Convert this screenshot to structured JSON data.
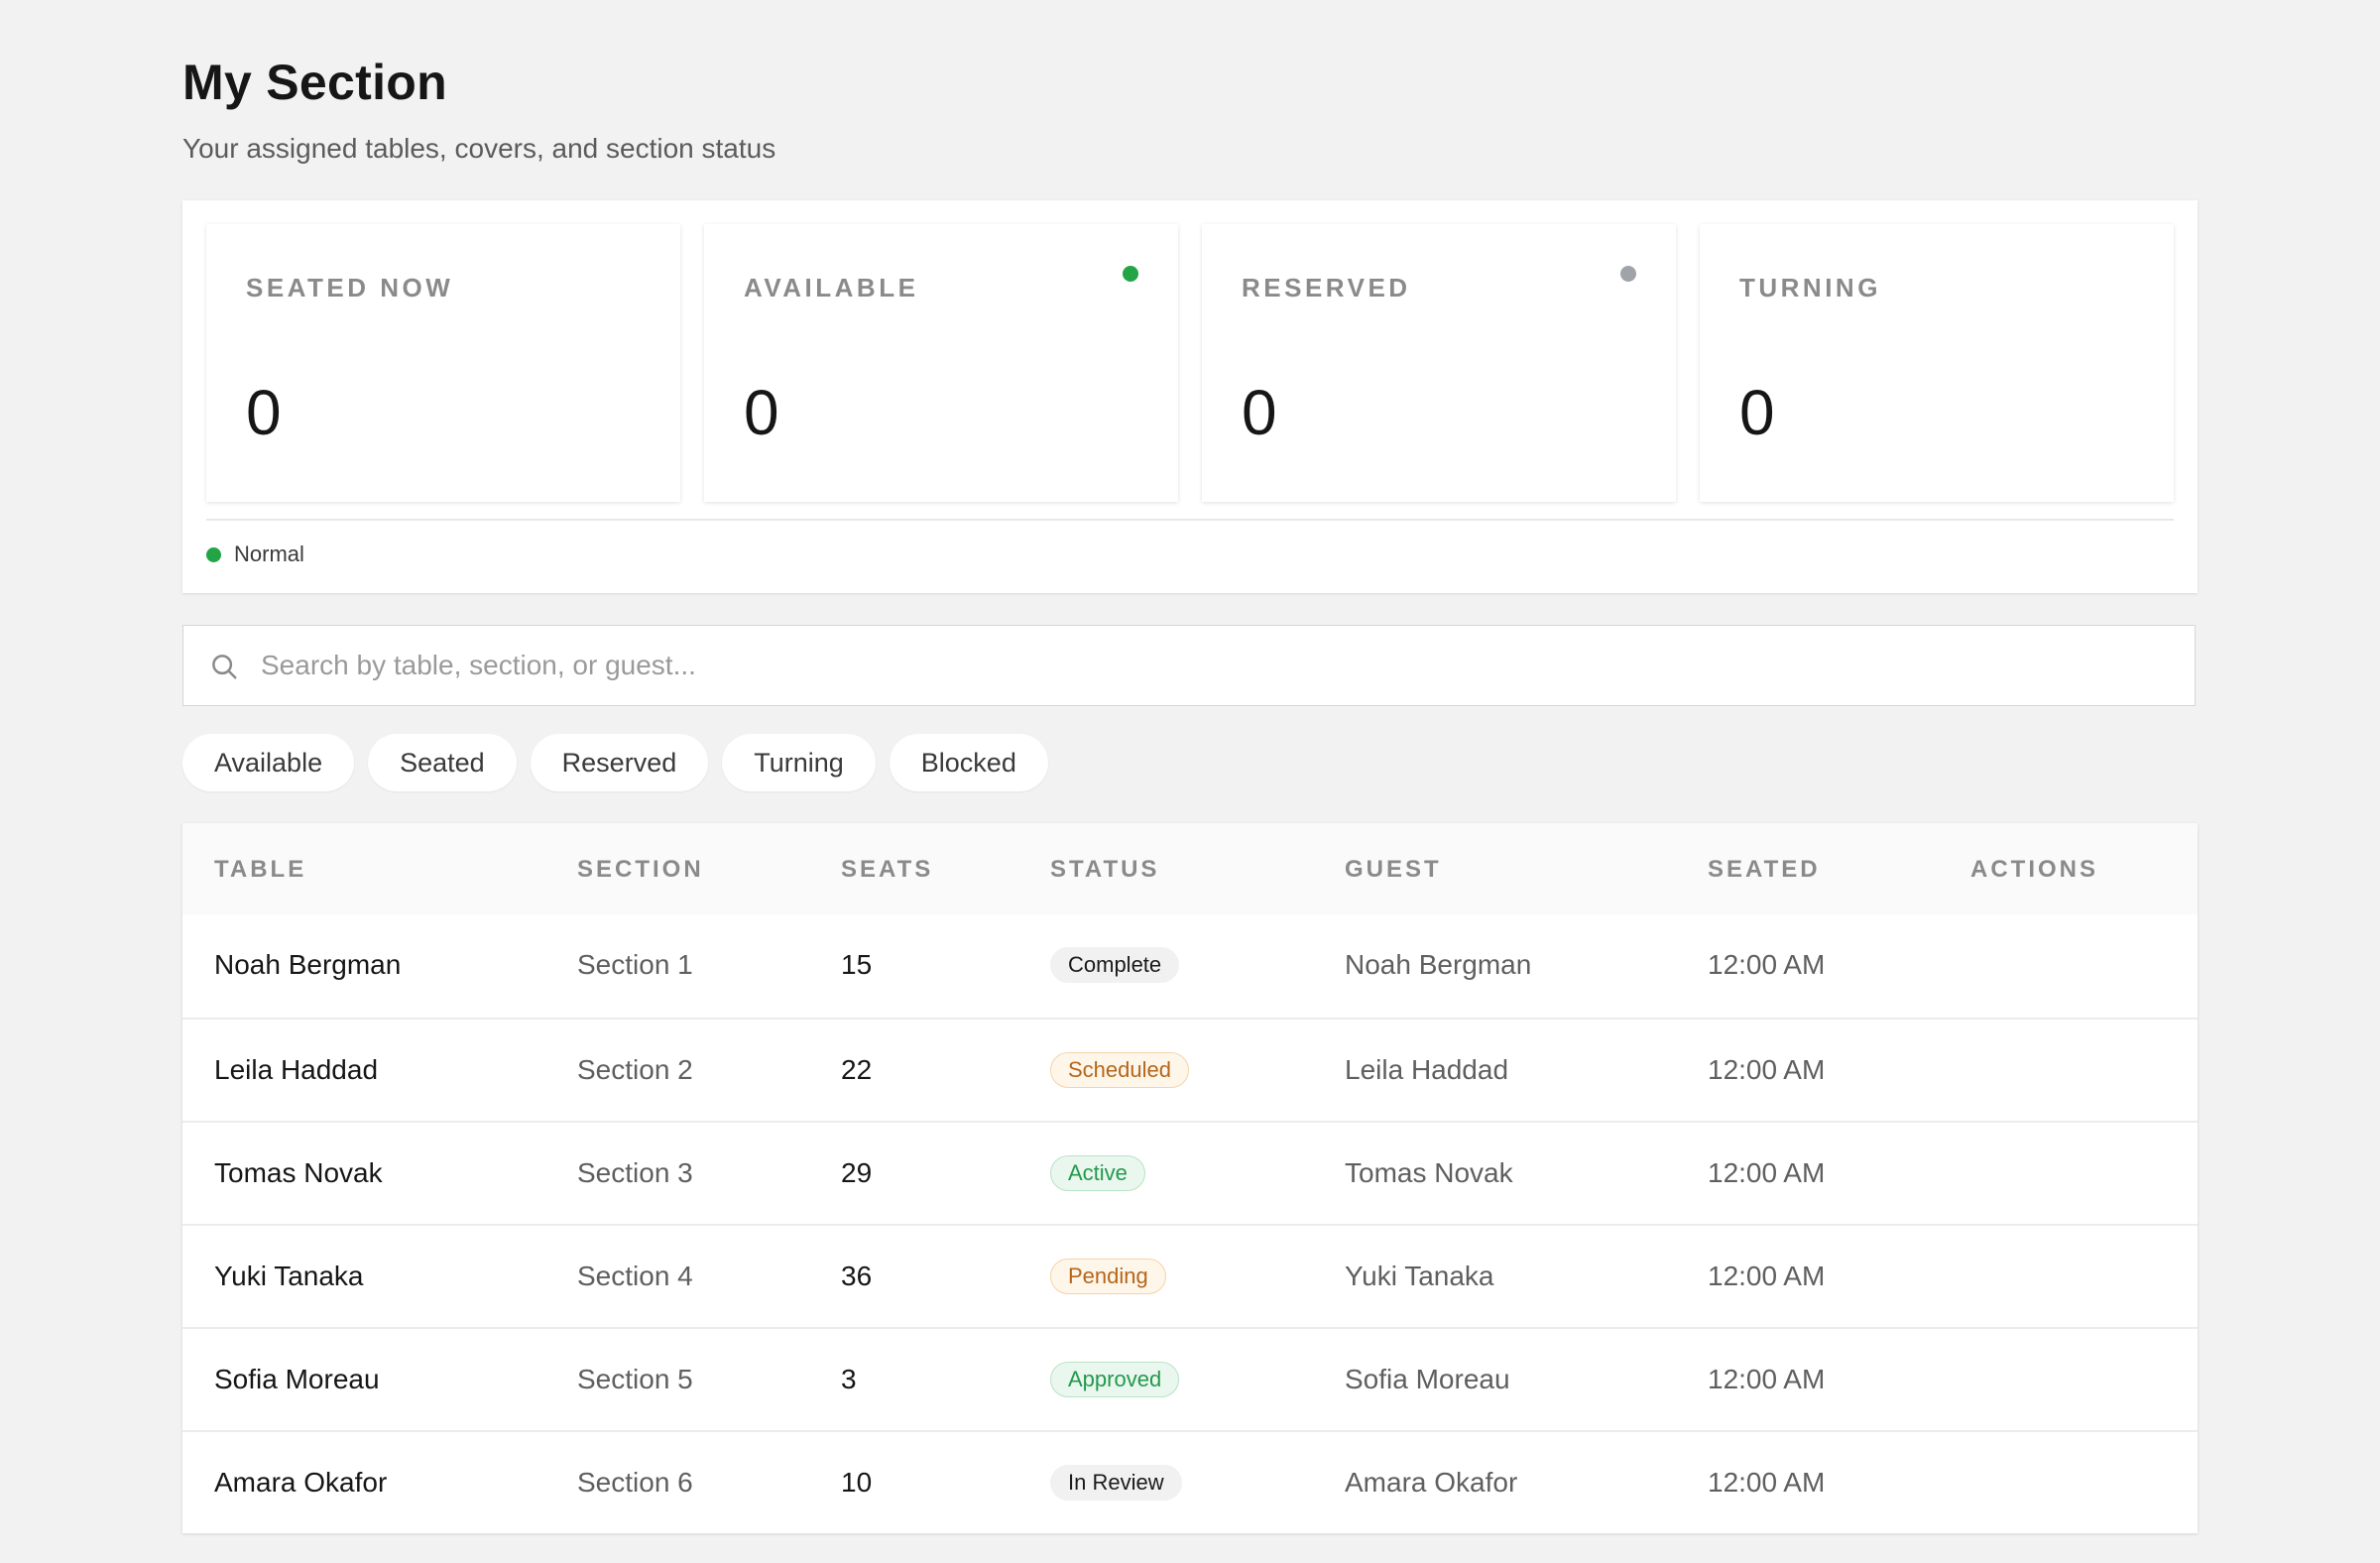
{
  "header": {
    "title": "My Section",
    "subtitle": "Your assigned tables, covers, and section status"
  },
  "stats": {
    "cards": [
      {
        "label": "SEATED NOW",
        "value": "0",
        "dot_color": null
      },
      {
        "label": "AVAILABLE",
        "value": "0",
        "dot_color": "#22a447"
      },
      {
        "label": "RESERVED",
        "value": "0",
        "dot_color": "#a0a3a8"
      },
      {
        "label": "TURNING",
        "value": "0",
        "dot_color": null
      }
    ],
    "status": {
      "label": "Normal",
      "dot_color": "#22a447"
    }
  },
  "search": {
    "placeholder": "Search by table, section, or guest...",
    "value": ""
  },
  "filters": [
    "Available",
    "Seated",
    "Reserved",
    "Turning",
    "Blocked"
  ],
  "table": {
    "columns": [
      "TABLE",
      "SECTION",
      "SEATS",
      "STATUS",
      "GUEST",
      "SEATED",
      "ACTIONS"
    ],
    "rows": [
      {
        "table": "Noah Bergman",
        "section": "Section 1",
        "seats": "15",
        "status": "Complete",
        "status_kind": "complete",
        "guest": "Noah Bergman",
        "seated": "12:00 AM"
      },
      {
        "table": "Leila Haddad",
        "section": "Section 2",
        "seats": "22",
        "status": "Scheduled",
        "status_kind": "scheduled",
        "guest": "Leila Haddad",
        "seated": "12:00 AM"
      },
      {
        "table": "Tomas Novak",
        "section": "Section 3",
        "seats": "29",
        "status": "Active",
        "status_kind": "active",
        "guest": "Tomas Novak",
        "seated": "12:00 AM"
      },
      {
        "table": "Yuki Tanaka",
        "section": "Section 4",
        "seats": "36",
        "status": "Pending",
        "status_kind": "pending",
        "guest": "Yuki Tanaka",
        "seated": "12:00 AM"
      },
      {
        "table": "Sofia Moreau",
        "section": "Section 5",
        "seats": "3",
        "status": "Approved",
        "status_kind": "approved",
        "guest": "Sofia Moreau",
        "seated": "12:00 AM"
      },
      {
        "table": "Amara Okafor",
        "section": "Section 6",
        "seats": "10",
        "status": "In Review",
        "status_kind": "review",
        "guest": "Amara Okafor",
        "seated": "12:00 AM"
      }
    ]
  }
}
